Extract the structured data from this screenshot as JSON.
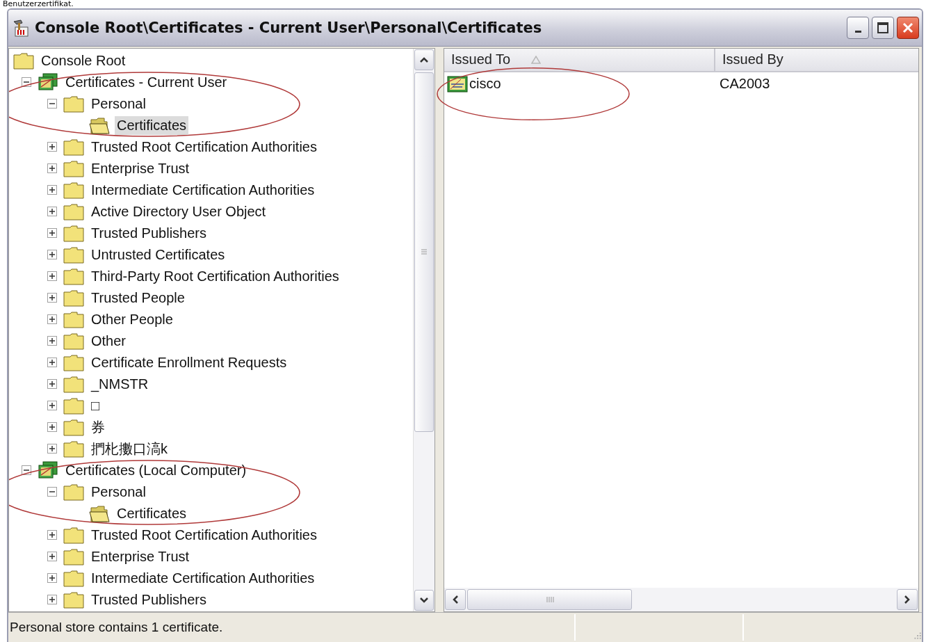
{
  "page_caption": "Benutzerzertifikat.",
  "window": {
    "title": "Console Root\\Certificates - Current User\\Personal\\Certificates"
  },
  "tree": [
    {
      "label": "Console Root",
      "kind": "folder",
      "selected": false,
      "children": [
        {
          "label": "Certificates - Current User",
          "kind": "snapin",
          "expanded": true,
          "selected": false,
          "children": [
            {
              "label": "Personal",
              "kind": "folder",
              "expanded": true,
              "selected": false,
              "circled": true,
              "children": [
                {
                  "label": "Certificates",
                  "kind": "open-folder",
                  "selected": true
                }
              ]
            },
            {
              "label": "Trusted Root Certification Authorities",
              "kind": "folder",
              "expanded": false,
              "selected": false
            },
            {
              "label": "Enterprise Trust",
              "kind": "folder",
              "expanded": false,
              "selected": false
            },
            {
              "label": "Intermediate Certification Authorities",
              "kind": "folder",
              "expanded": false,
              "selected": false
            },
            {
              "label": "Active Directory User Object",
              "kind": "folder",
              "expanded": false,
              "selected": false
            },
            {
              "label": "Trusted Publishers",
              "kind": "folder",
              "expanded": false,
              "selected": false
            },
            {
              "label": "Untrusted Certificates",
              "kind": "folder",
              "expanded": false,
              "selected": false
            },
            {
              "label": "Third-Party Root Certification Authorities",
              "kind": "folder",
              "expanded": false,
              "selected": false
            },
            {
              "label": "Trusted People",
              "kind": "folder",
              "expanded": false,
              "selected": false
            },
            {
              "label": "Other People",
              "kind": "folder",
              "expanded": false,
              "selected": false
            },
            {
              "label": "Other",
              "kind": "folder",
              "expanded": false,
              "selected": false
            },
            {
              "label": "Certificate Enrollment Requests",
              "kind": "folder",
              "expanded": false,
              "selected": false
            },
            {
              "label": "_NMSTR",
              "kind": "folder",
              "expanded": false,
              "selected": false
            },
            {
              "label": "□",
              "kind": "folder",
              "expanded": false,
              "selected": false
            },
            {
              "label": "券",
              "kind": "folder",
              "expanded": false,
              "selected": false
            },
            {
              "label": "捫朼擻口滈k",
              "kind": "folder",
              "expanded": false,
              "selected": false
            }
          ]
        },
        {
          "label": "Certificates (Local Computer)",
          "kind": "snapin",
          "expanded": true,
          "selected": false,
          "children": [
            {
              "label": "Personal",
              "kind": "folder",
              "expanded": true,
              "selected": false,
              "circled": true,
              "children": [
                {
                  "label": "Certificates",
                  "kind": "open-folder",
                  "selected": false
                }
              ]
            },
            {
              "label": "Trusted Root Certification Authorities",
              "kind": "folder",
              "expanded": false,
              "selected": false
            },
            {
              "label": "Enterprise Trust",
              "kind": "folder",
              "expanded": false,
              "selected": false
            },
            {
              "label": "Intermediate Certification Authorities",
              "kind": "folder",
              "expanded": false,
              "selected": false
            },
            {
              "label": "Trusted Publishers",
              "kind": "folder",
              "expanded": false,
              "selected": false
            }
          ]
        }
      ]
    }
  ],
  "table": {
    "columns": [
      {
        "label": "Issued To",
        "sorted": true
      },
      {
        "label": "Issued By",
        "sorted": false
      }
    ],
    "rows": [
      {
        "issued_to": "cisco",
        "issued_by": "CA2003",
        "circled": true
      }
    ]
  },
  "status_bar": {
    "text": "Personal store contains 1 certificate."
  }
}
